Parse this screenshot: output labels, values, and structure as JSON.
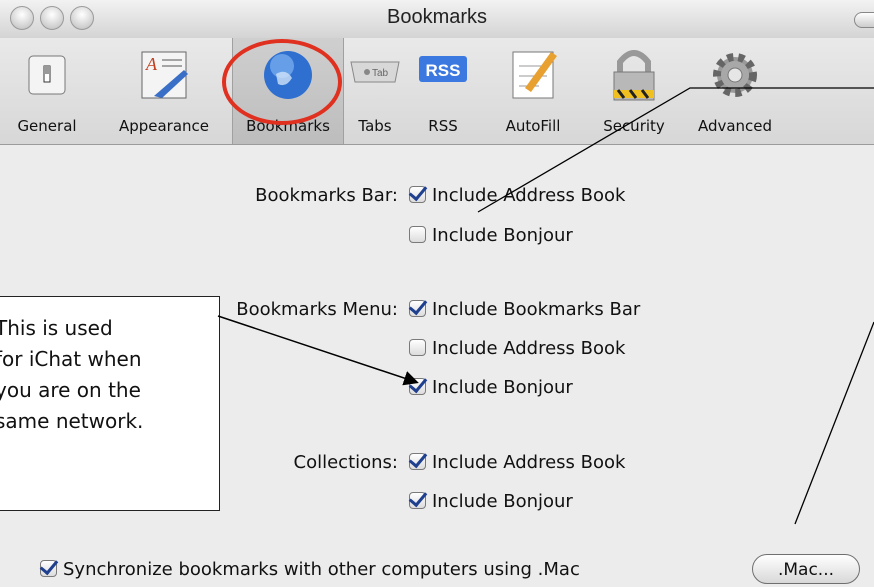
{
  "window": {
    "title": "Bookmarks"
  },
  "toolbar": {
    "items": [
      {
        "label": "General",
        "icon": "switch-icon"
      },
      {
        "label": "Appearance",
        "icon": "appearance-icon"
      },
      {
        "label": "Bookmarks",
        "icon": "globe-icon",
        "selected": true
      },
      {
        "label": "Tabs",
        "icon": "tab-icon"
      },
      {
        "label": "RSS",
        "icon": "rss-icon"
      },
      {
        "label": "AutoFill",
        "icon": "autofill-icon"
      },
      {
        "label": "Security",
        "icon": "lock-icon"
      },
      {
        "label": "Advanced",
        "icon": "gear-icon"
      }
    ],
    "tab_icon_text": "Tab",
    "rss_icon_text": "RSS"
  },
  "sections": {
    "bookmarks_bar": {
      "label": "Bookmarks Bar:",
      "options": [
        {
          "label": "Include Address Book",
          "checked": true
        },
        {
          "label": "Include Bonjour",
          "checked": false
        }
      ]
    },
    "bookmarks_menu": {
      "label": "Bookmarks Menu:",
      "options": [
        {
          "label": "Include Bookmarks Bar",
          "checked": true
        },
        {
          "label": "Include Address Book",
          "checked": false
        },
        {
          "label": "Include Bonjour",
          "checked": true
        }
      ]
    },
    "collections": {
      "label": "Collections:",
      "options": [
        {
          "label": "Include Address Book",
          "checked": true
        },
        {
          "label": "Include Bonjour",
          "checked": true
        }
      ]
    }
  },
  "sync": {
    "label": "Synchronize bookmarks with other computers using .Mac",
    "checked": true
  },
  "mac_button": {
    "label": ".Mac..."
  },
  "callout": {
    "lines": [
      "This is used",
      "for iChat when",
      "you are on the",
      "same network."
    ]
  },
  "colors": {
    "highlight_ring": "#e03020",
    "checkmark": "#1f3f8f"
  }
}
